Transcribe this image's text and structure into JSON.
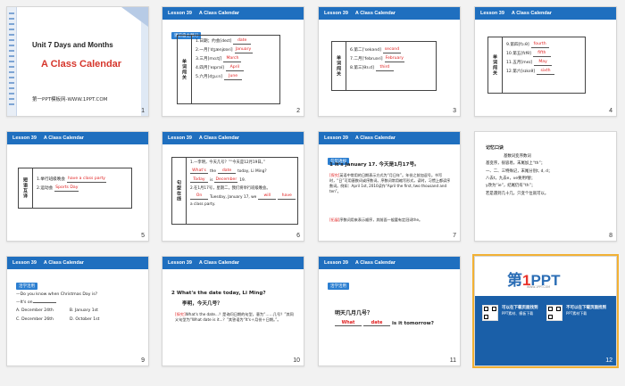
{
  "header": {
    "lesson": "Lesson 39",
    "title": "A Class Calendar"
  },
  "slides": [
    {
      "num": "1",
      "unit": "Unit 7  Days and Months",
      "title": "A Class Calendar",
      "template": "第一PPT模板网-WWW.1PPT.COM"
    },
    {
      "num": "2",
      "tag": "课前自主预习",
      "label": "单词闯关",
      "rows": [
        {
          "q": "1.日期；约会[deɪt]",
          "a": "date"
        },
        {
          "q": "2.一月['dʒænjʊəri]",
          "a": "January"
        },
        {
          "q": "3.三月[mɑːtʃ]",
          "a": "March"
        },
        {
          "q": "4.四月['eɪprəl]",
          "a": "April"
        },
        {
          "q": "5.六月[dʒuːn]",
          "a": "June"
        }
      ]
    },
    {
      "num": "3",
      "label": "单词闯关",
      "rows": [
        {
          "q": "6.第二['sekənd]",
          "a": "second"
        },
        {
          "q": "7.二月['februəri]",
          "a": "February"
        },
        {
          "q": "8.第三[θɜːd]",
          "a": "third"
        }
      ]
    },
    {
      "num": "4",
      "label": "单词闯关",
      "rows": [
        {
          "q": "9.第四[fɔːθ]",
          "a": "fourth"
        },
        {
          "q": "10.第五[fɪfθ]",
          "a": "fifth"
        },
        {
          "q": "11.五月[meɪ]",
          "a": "May"
        },
        {
          "q": "12.第六[sɪksθ]",
          "a": "sixth"
        }
      ]
    },
    {
      "num": "5",
      "label": "短语互译",
      "rows": [
        {
          "q": "1.举行班级晚会",
          "a": "have a class party"
        },
        {
          "q": "2.运动会",
          "a": "Sports Day"
        }
      ]
    },
    {
      "num": "6",
      "label": "句型在线",
      "l1": "1.—李明，今天几号？”“今天是12月19日。”",
      "l2a": "What's",
      "l2b": "the",
      "l2c": "date",
      "l2d": "today, Li Ming?",
      "l3a": "Today",
      "l3b": "is",
      "l3c": "December",
      "l3d": "19.",
      "l4": "2.在1月17号，星期二，我们将举行班级晚会。",
      "l5a": "On",
      "l5b": "Tuesday, January 17, we",
      "l5c": "will",
      "l5d": "have",
      "l6": "a class party."
    },
    {
      "num": "7",
      "tag": "句型透视",
      "head": "1    It's January 17. 今天是1月17号。",
      "p1k": "[探究]",
      "p1": "英语中常用的日期表示方式为“月日年”。年份之前加逗号。书写时，“日”可用基数词或序数词。序数词常用缩写形式，读时，习惯上都读序数词。例如：April 1st, 2010读作“April the first, two thousand and ten”。",
      "p2k": "[拓展]",
      "p2": "序数词用来表示顺序，其前面一般要有定冠词the。"
    },
    {
      "num": "8",
      "head": "记忆口诀",
      "lines": [
        "基数词变序数词",
        "基变序，很容易，末尾加上“th”；",
        "一、二、三特殊记，末尾分别t, d, d；",
        "八去t，九去e，ve要用f替；",
        "y改为“ie”，结尾仍有“th”；",
        "若是遇到几十几，只变个位就可以。"
      ]
    },
    {
      "num": "9",
      "tag": "活学活用",
      "q": "—Do you know when Christmas Day is?",
      "q2": "—It's on",
      "optA": "A.  December 24th",
      "optB": "B.  January 1st",
      "optC": "C.  December 26th",
      "optD": "D.  October 1st"
    },
    {
      "num": "10",
      "head": "2    What's the date today, Li Ming?",
      "head2": "李明，今天几号？",
      "pk": "[探究]",
      "p": "What's the date...？是询问日期的句型，意为“……几号？”其同义句型为“What date is it...？”其答语为“It's＋月份＋日期。”。"
    },
    {
      "num": "11",
      "tag": "活学活用",
      "q": "明天几月几号？",
      "a1": "What",
      "a2": "date",
      "q2": "is it tomorrow?"
    },
    {
      "num": "12",
      "logo": "第1PPT",
      "sub": "WWW.1PPT.COM",
      "b1": "可以在下载页面找到",
      "b2": "PPT素材、模板下载",
      "b3": "不可以在下载页面找到",
      "b4": "PPT素材下载"
    }
  ]
}
